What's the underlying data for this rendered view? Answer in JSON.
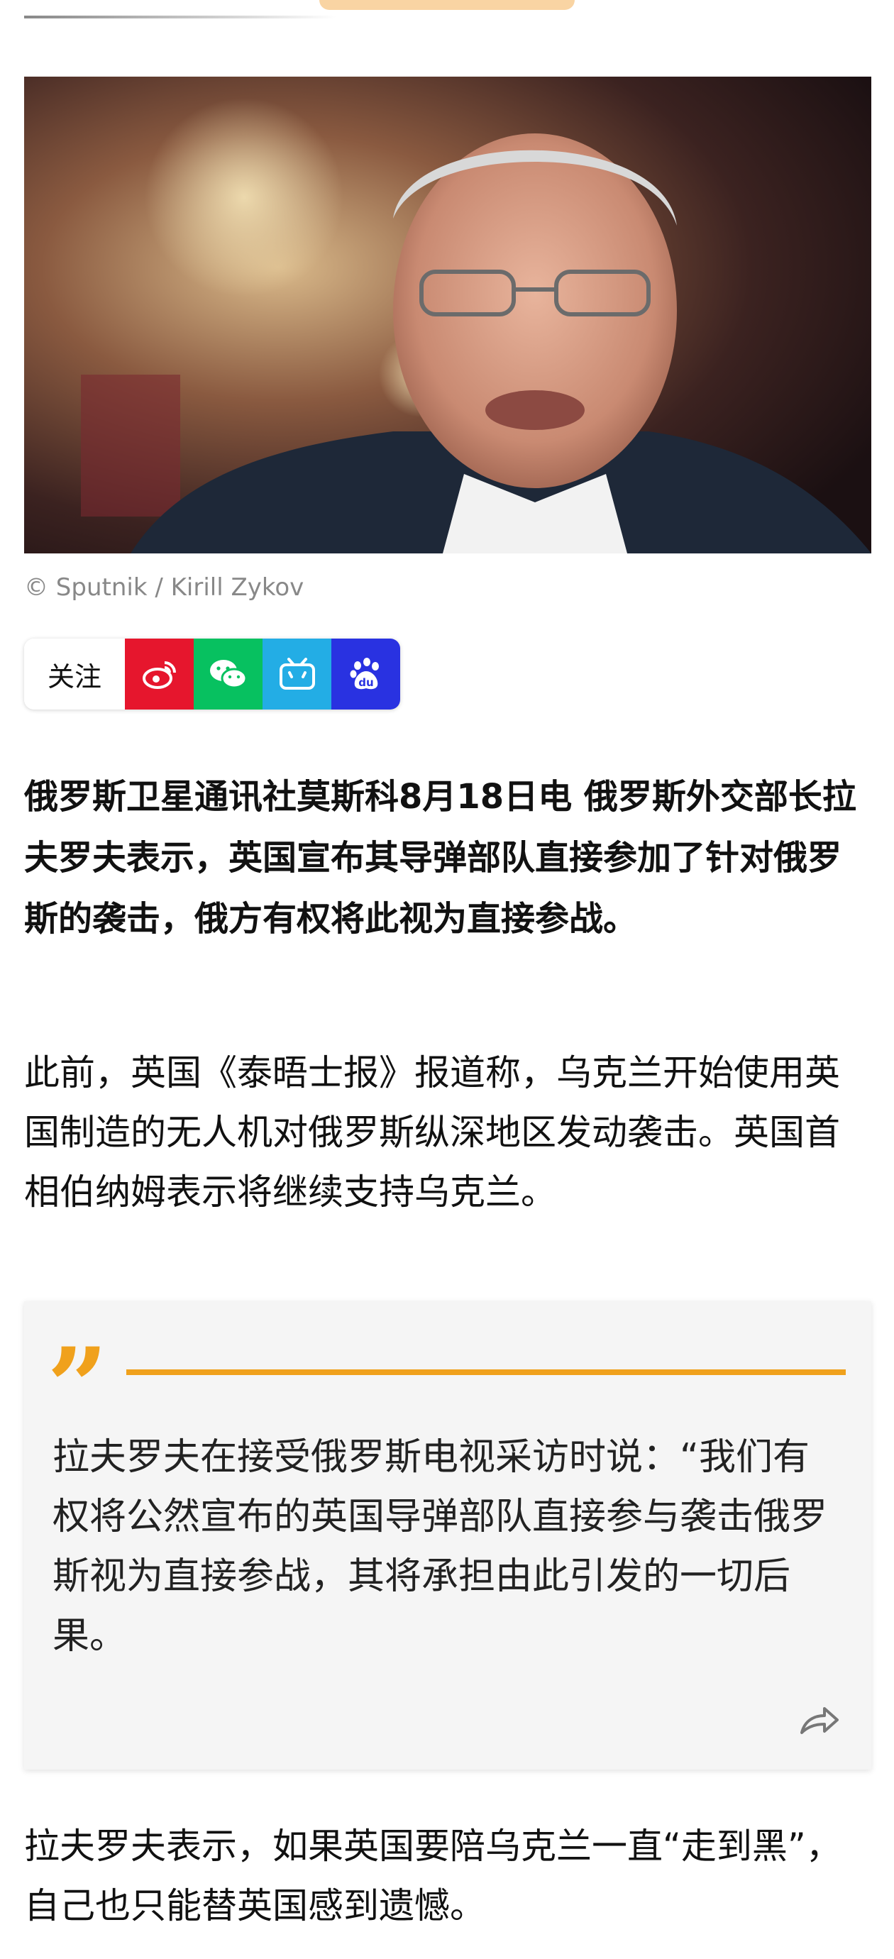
{
  "photo": {
    "caption": "© Sputnik / Kirill Zykov"
  },
  "share_bar": {
    "follow_label": "关注",
    "buttons": [
      {
        "icon": "weibo-icon",
        "color": "#e6162d"
      },
      {
        "icon": "wechat-icon",
        "color": "#07c160"
      },
      {
        "icon": "bilibili-icon",
        "color": "#23ade5"
      },
      {
        "icon": "baidu-icon",
        "color": "#2932e1"
      }
    ]
  },
  "article": {
    "lead": "俄罗斯卫星通讯社莫斯科8月18日电 俄罗斯外交部长拉夫罗夫表示，英国宣布其导弹部队直接参加了针对俄罗斯的袭击，俄方有权将此视为直接参战。",
    "paragraph_1": "此前，英国《泰晤士报》报道称，乌克兰开始使用英国制造的无人机对俄罗斯纵深地区发动袭击。英国首相伯纳姆表示将继续支持乌克兰。",
    "quote": "拉夫罗夫在接受俄罗斯电视采访时说：“我们有权将公然宣布的英国导弹部队直接参与袭击俄罗斯视为直接参战，其将承担由此引发的一切后果。",
    "paragraph_2": "拉夫罗夫表示，如果英国要陪乌克兰一直“走到黑”，自己也只能替英国感到遗憾。"
  },
  "colors": {
    "accent": "#f0a11c"
  }
}
